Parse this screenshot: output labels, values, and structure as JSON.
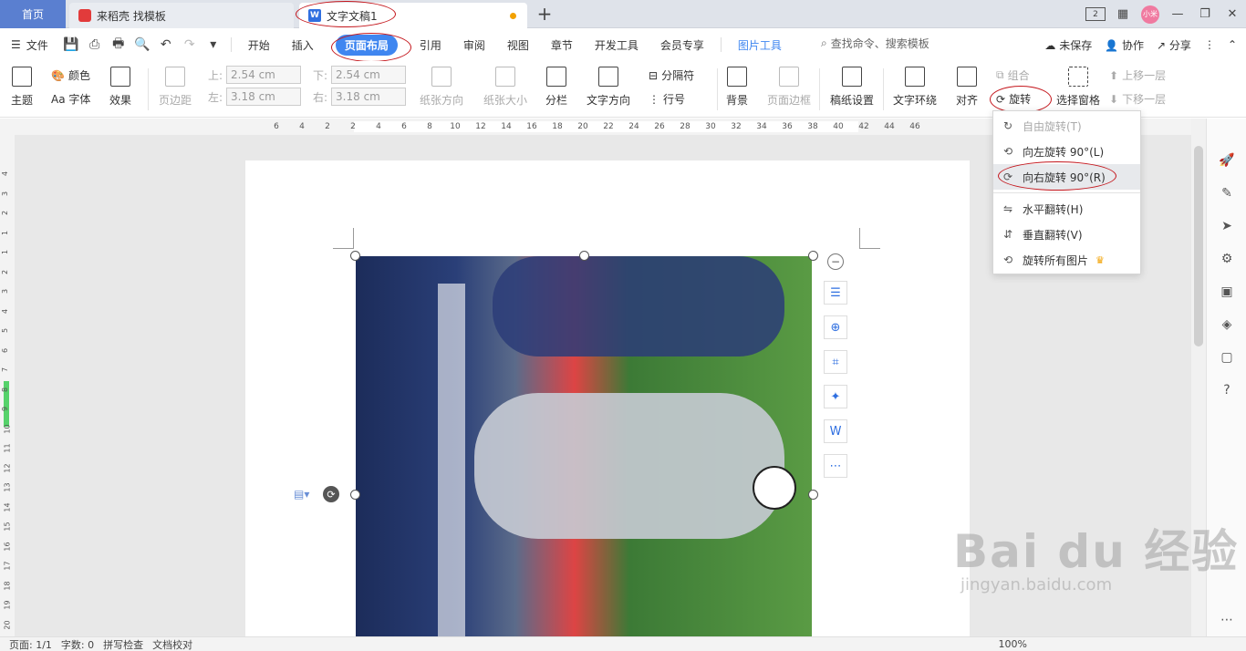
{
  "tabs": {
    "home": "首页",
    "tab1": "来稻壳 找模板",
    "tab2": "文字文稿1",
    "add": "+",
    "window_badge": "2",
    "avatar": "小米"
  },
  "menu": {
    "file": "文件",
    "items": [
      "开始",
      "插入",
      "页面布局",
      "引用",
      "审阅",
      "视图",
      "章节",
      "开发工具",
      "会员专享"
    ],
    "picture_tools": "图片工具",
    "search": "查找命令、搜索模板",
    "unsaved": "未保存",
    "collab": "协作",
    "share": "分享"
  },
  "ribbon": {
    "theme": "主题",
    "color": "颜色",
    "font": "Aa 字体",
    "effect": "效果",
    "margins": "页边距",
    "top_label": "上:",
    "top_value": "2.54 cm",
    "bottom_label": "下:",
    "bottom_value": "2.54 cm",
    "left_label": "左:",
    "left_value": "3.18 cm",
    "right_label": "右:",
    "right_value": "3.18 cm",
    "orientation": "纸张方向",
    "size": "纸张大小",
    "columns": "分栏",
    "text_direction": "文字方向",
    "separator": "分隔符",
    "line_number": "行号",
    "background": "背景",
    "page_border": "页面边框",
    "manuscript": "稿纸设置",
    "wrap": "文字环绕",
    "align": "对齐",
    "rotate": "旋转",
    "group": "组合",
    "selection_pane": "选择窗格",
    "bring_forward": "上移一层",
    "send_backward": "下移一层"
  },
  "rotate_menu": {
    "free": "自由旋转(T)",
    "left90": "向左旋转 90°(L)",
    "right90": "向右旋转 90°(R)",
    "flip_h": "水平翻转(H)",
    "flip_v": "垂直翻转(V)",
    "rotate_all": "旋转所有图片"
  },
  "ruler": {
    "h_ticks": [
      "6",
      "4",
      "2",
      "2",
      "4",
      "6",
      "8",
      "10",
      "12",
      "14",
      "16",
      "18",
      "20",
      "22",
      "24",
      "26",
      "28",
      "30",
      "32",
      "34",
      "36",
      "38",
      "40",
      "42",
      "44",
      "46"
    ],
    "v_ticks": [
      "4",
      "3",
      "2",
      "1",
      "1",
      "2",
      "3",
      "4",
      "5",
      "6",
      "7",
      "8",
      "9",
      "10",
      "11",
      "12",
      "13",
      "14",
      "15",
      "16",
      "17",
      "18",
      "19",
      "20"
    ]
  },
  "status": {
    "page": "页面: 1/1",
    "words": "字数: 0",
    "spell": "拼写检查",
    "proof": "文档校对",
    "zoom": "100%"
  },
  "watermark": {
    "brand": "Bai du 经验",
    "url": "jingyan.baidu.com"
  },
  "colors": {
    "accent": "#3f86f0",
    "home_tab": "#5a7fd0",
    "annotation": "#c4161c"
  }
}
